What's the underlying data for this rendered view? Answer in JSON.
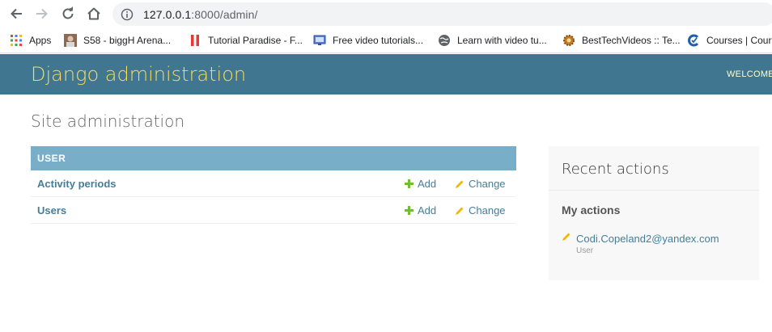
{
  "browser": {
    "url_host": "127.0.0.1",
    "url_path": ":8000/admin/",
    "bookmarks": [
      {
        "label": "Apps",
        "icon": "apps-grid-icon"
      },
      {
        "label": "S58 - biggH Arena...",
        "icon": "avatar-icon"
      },
      {
        "label": "Tutorial Paradise - F...",
        "icon": "bookmark-red-icon"
      },
      {
        "label": "Free video tutorials...",
        "icon": "monitor-icon"
      },
      {
        "label": "Learn with video tu...",
        "icon": "globe-icon"
      },
      {
        "label": "BestTechVideos :: Te...",
        "icon": "gear-icon"
      },
      {
        "label": "Courses | Cours",
        "icon": "courses-icon"
      }
    ]
  },
  "header": {
    "branding": "Django administration",
    "welcome": "WELCOME"
  },
  "page": {
    "title": "Site administration"
  },
  "app_module": {
    "caption": "USER",
    "models": [
      {
        "name": "Activity periods",
        "add_label": "Add",
        "change_label": "Change"
      },
      {
        "name": "Users",
        "add_label": "Add",
        "change_label": "Change"
      }
    ]
  },
  "recent_actions": {
    "title": "Recent actions",
    "subtitle": "My actions",
    "items": [
      {
        "label": "Codi.Copeland2@yandex.com",
        "type": "User"
      }
    ]
  },
  "colors": {
    "header_bg": "#417690",
    "branding": "#f5dd5d",
    "caption_bg": "#79aec8",
    "link": "#447e9b",
    "add_icon": "#70bf2b",
    "change_icon": "#efb80b"
  }
}
